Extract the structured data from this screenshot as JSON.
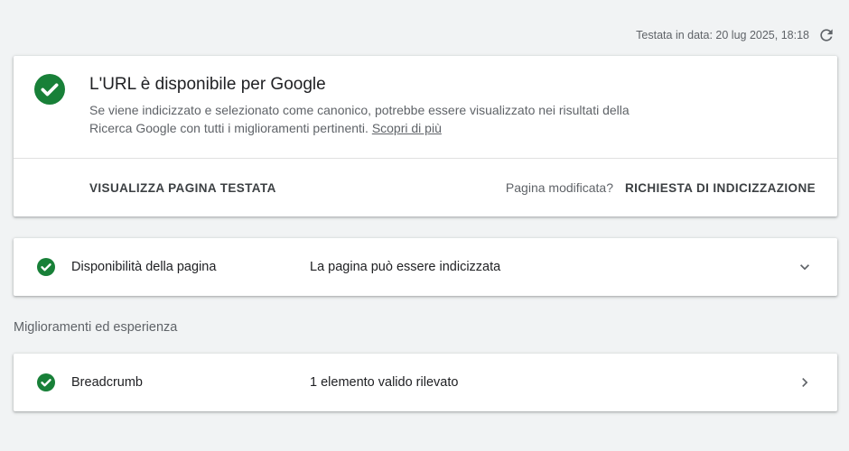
{
  "header": {
    "tested_label": "Testata in data: 20 lug 2025, 18:18",
    "refresh_icon": "refresh-icon"
  },
  "status_card": {
    "icon": "check-circle-icon",
    "title": "L'URL è disponibile per Google",
    "description": "Se viene indicizzato e selezionato come canonico, potrebbe essere visualizzato nei risultati della Ricerca Google con tutti i miglioramenti pertinenti.",
    "learn_more": "Scopri di più",
    "view_button": "VISUALIZZA PAGINA TESTATA",
    "modified_question": "Pagina modificata?",
    "request_button": "RICHIESTA DI INDICIZZAZIONE"
  },
  "availability": {
    "icon": "check-circle-icon",
    "label": "Disponibilità della pagina",
    "value": "La pagina può essere indicizzata",
    "chevron_icon": "chevron-down-icon"
  },
  "enhancements": {
    "heading": "Miglioramenti ed esperienza",
    "items": [
      {
        "icon": "check-circle-icon",
        "label": "Breadcrumb",
        "value": "1 elemento valido rilevato",
        "chevron_icon": "chevron-right-icon"
      }
    ]
  },
  "colors": {
    "background": "#f1f3f4",
    "success_green": "#188038",
    "text_primary": "#202124",
    "text_secondary": "#5f6368"
  }
}
